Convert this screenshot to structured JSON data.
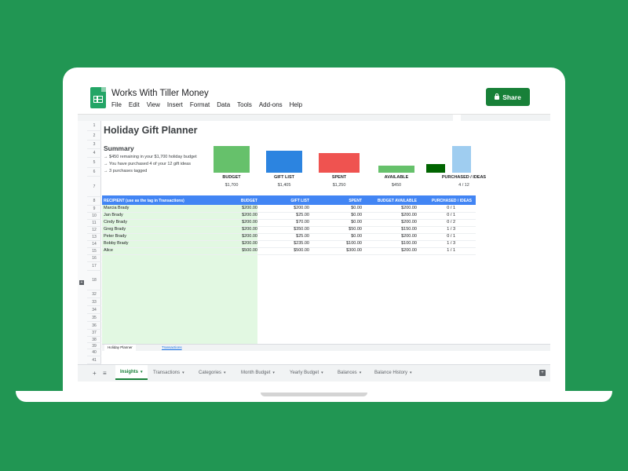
{
  "app": {
    "doc_title": "Works With Tiller Money",
    "menu": [
      "File",
      "Edit",
      "View",
      "Insert",
      "Format",
      "Data",
      "Tools",
      "Add-ons",
      "Help"
    ],
    "share_label": "Share"
  },
  "sheet": {
    "title": "Holiday Gift Planner",
    "summary": {
      "heading": "Summary",
      "lines": [
        "→ $450 remaining in your $1,700 holiday budget",
        "→ You have purchased 4 of your 12 gift ideas",
        "→ 3 purchases tagged"
      ]
    },
    "row_numbers": [
      "1",
      "2",
      "3",
      "4",
      "5",
      "6",
      "7",
      "8",
      "9",
      "10",
      "11",
      "12",
      "13",
      "14",
      "15",
      "16",
      "17",
      "18",
      "32",
      "33",
      "34",
      "35",
      "36",
      "37",
      "38",
      "39",
      "40",
      "41"
    ],
    "summary_bars": [
      {
        "label": "BUDGET",
        "value": "$1,700",
        "amount": 1700,
        "color": "#66c16b"
      },
      {
        "label": "GIFT LIST",
        "value": "$1,405",
        "amount": 1405,
        "color": "#2c84e0"
      },
      {
        "label": "SPENT",
        "value": "$1,250",
        "amount": 1250,
        "color": "#ef5350"
      },
      {
        "label": "AVAILABLE",
        "value": "$450",
        "amount": 450,
        "color": "#66c16b"
      },
      {
        "label": "PURCHASED / IDEAS",
        "value": "4 / 12",
        "amount": 0.333,
        "color": "#006400",
        "color2": "#9fcdf0"
      }
    ],
    "table": {
      "headers": [
        "RECIPIENT (use as the tag in Transactions)",
        "BUDGET",
        "GIFT LIST",
        "SPENT",
        "BUDGET AVAILABLE",
        "PURCHASED / IDEAS"
      ],
      "rows": [
        [
          "Marcia Brady",
          "$200.00",
          "$200.00",
          "$0.00",
          "$200.00",
          "0 / 1"
        ],
        [
          "Jan Brady",
          "$200.00",
          "$25.00",
          "$0.00",
          "$200.00",
          "0 / 1"
        ],
        [
          "Cindy Brady",
          "$200.00",
          "$70.00",
          "$0.00",
          "$200.00",
          "0 / 2"
        ],
        [
          "Greg Brady",
          "$200.00",
          "$350.00",
          "$50.00",
          "$150.00",
          "1 / 3"
        ],
        [
          "Peter Brady",
          "$200.00",
          "$25.00",
          "$0.00",
          "$200.00",
          "0 / 1"
        ],
        [
          "Bobby Brady",
          "$200.00",
          "$235.00",
          "$100.00",
          "$100.00",
          "1 / 3"
        ],
        [
          "Alice",
          "$500.00",
          "$500.00",
          "$300.00",
          "$200.00",
          "1 / 1"
        ]
      ]
    },
    "inner_tabs": [
      "Holiday Planner",
      "Transactions"
    ]
  },
  "bottom_tabs": [
    "Insights",
    "Transactions",
    "Categories",
    "Month Budget",
    "Yearly Budget",
    "Balances",
    "Balance History"
  ],
  "active_tab": "Insights",
  "colors": {
    "background": "#219653",
    "share": "#188038",
    "header_blue": "#4285f4",
    "recipient_highlight": "#e2f8e2"
  }
}
